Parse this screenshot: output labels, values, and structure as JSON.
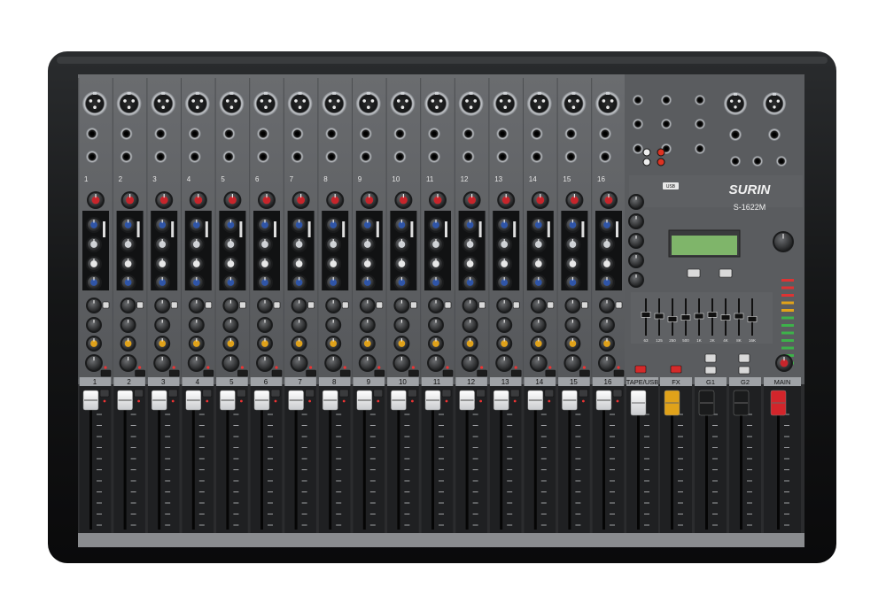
{
  "brand": {
    "name": "SURIN",
    "model": "S-1622M",
    "usb_badge": "USB"
  },
  "channels": [
    "1",
    "2",
    "3",
    "4",
    "5",
    "6",
    "7",
    "8",
    "9",
    "10",
    "11",
    "12",
    "13",
    "14",
    "15",
    "16"
  ],
  "bus_labels": [
    "TAPE/USB",
    "FX",
    "G1",
    "G2",
    "MAIN"
  ],
  "eq_bands": [
    "63",
    "125",
    "250",
    "500",
    "1K",
    "2K",
    "4K",
    "8K",
    "16K"
  ],
  "colors": {
    "panel": "#5e6063",
    "fader_panel": "#2a2b2d",
    "frame": "#111213",
    "gain_knob": "#c7252b",
    "eq_knob": "#2f55a8",
    "aux_knob": "#e0a21a",
    "fx_fader": "#e0a21a",
    "main_fader": "#d3252b",
    "lcd": "#7fb56a"
  }
}
